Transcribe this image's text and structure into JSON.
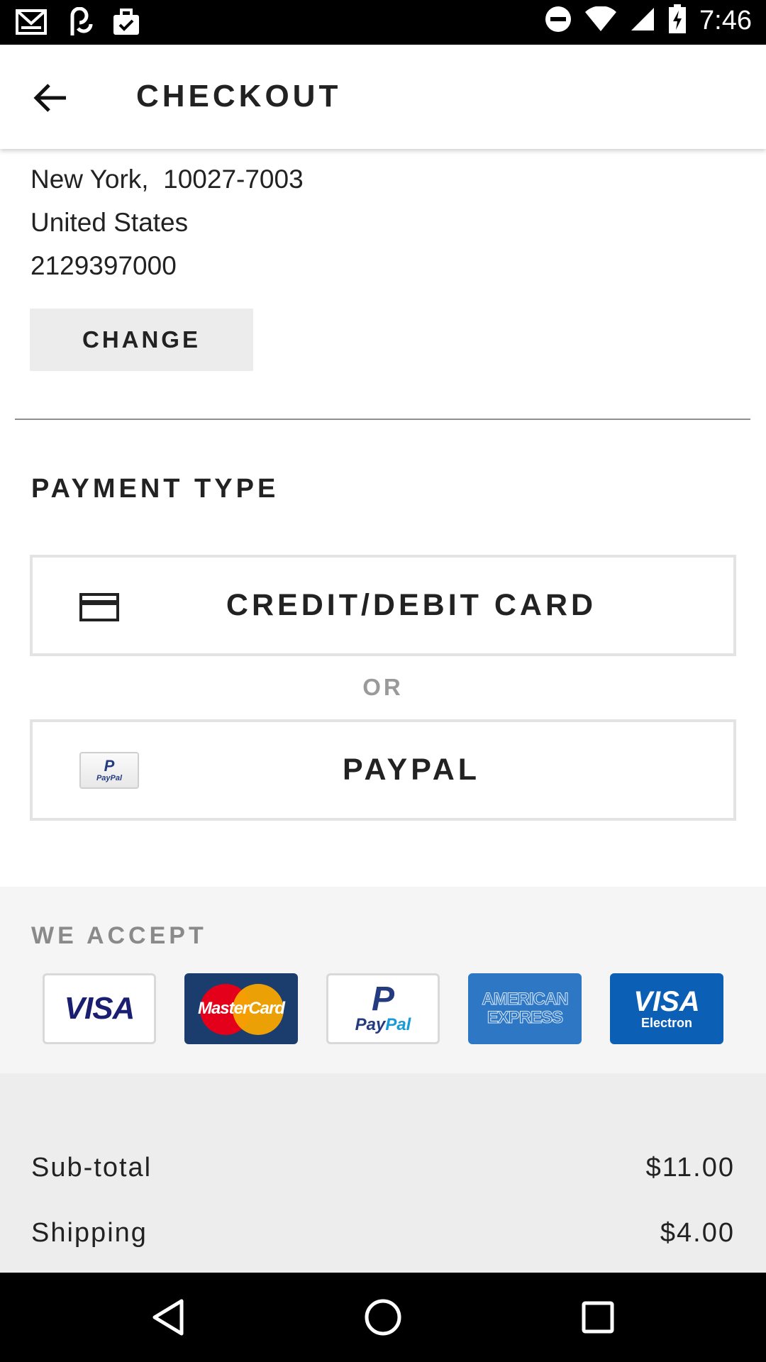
{
  "status_bar": {
    "time": "7:46",
    "left_icons": [
      "gmail-icon",
      "link-app-icon",
      "briefcase-check-icon"
    ],
    "right_icons": [
      "do-not-disturb-icon",
      "wifi-icon",
      "signal-icon",
      "battery-charging-icon"
    ]
  },
  "header": {
    "title": "CHECKOUT",
    "back_icon": "arrow-back-icon"
  },
  "address": {
    "city_line": "New York,  10027-7003",
    "country": "United States",
    "phone": "2129397000",
    "change_label": "CHANGE"
  },
  "payment": {
    "title": "PAYMENT TYPE",
    "card_label": "CREDIT/DEBIT CARD",
    "or_label": "OR",
    "paypal_label": "PAYPAL",
    "paypal_icon_p": "P",
    "paypal_icon_text": "PayPal"
  },
  "accept": {
    "title": "WE ACCEPT",
    "cards": [
      "VISA",
      "MasterCard",
      "PayPal",
      "AMERICAN EXPRESS",
      "VISA Electron"
    ],
    "visa_text": "VISA",
    "mastercard_text": "MasterCard",
    "paypal_p": "P",
    "paypal_text_1": "Pay",
    "paypal_text_2": "Pal",
    "amex_line1": "AMERICAN",
    "amex_line2": "EXPRESS",
    "visa_electron_1": "VISA",
    "visa_electron_2": "Electron"
  },
  "totals": {
    "subtotal_label": "Sub-total",
    "subtotal_value": "$11.00",
    "shipping_label": "Shipping",
    "shipping_value": "$4.00"
  },
  "nav": {
    "back": "nav-back-icon",
    "home": "nav-home-icon",
    "recents": "nav-recents-icon"
  },
  "colors": {
    "accent_text": "#222222",
    "muted": "#9a9a9a",
    "accept_bg": "#f5f5f5",
    "totals_bg": "#ededed"
  }
}
